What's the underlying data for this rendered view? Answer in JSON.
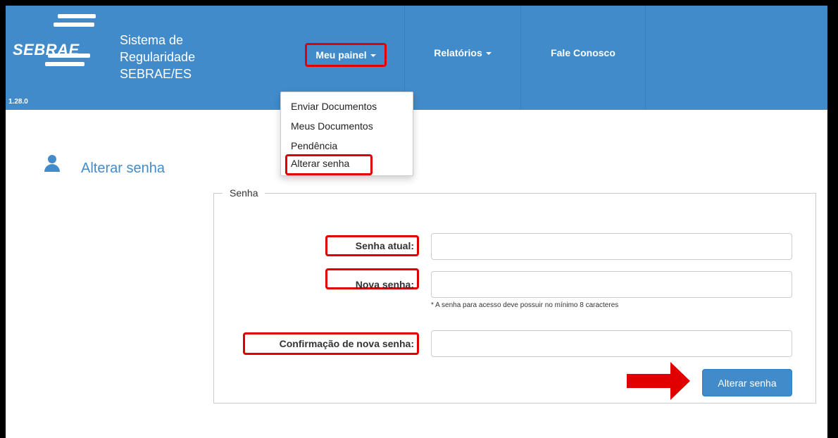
{
  "brand": {
    "logo_text": "SEBRAE",
    "title_line1": "Sistema de",
    "title_line2": "Regularidade",
    "title_line3": "SEBRAE/ES",
    "version": "1.28.0"
  },
  "nav": {
    "items": [
      {
        "label": "Meu painel"
      },
      {
        "label": "Relatórios"
      },
      {
        "label": "Fale Conosco"
      }
    ]
  },
  "dropdown": {
    "items": [
      {
        "label": "Enviar Documentos"
      },
      {
        "label": "Meus Documentos"
      },
      {
        "label": "Pendência"
      },
      {
        "label": "Alterar senha"
      }
    ]
  },
  "page": {
    "title": "Alterar senha",
    "fieldset_legend": "Senha"
  },
  "form": {
    "current_password_label": "Senha atual:",
    "new_password_label": "Nova senha:",
    "confirm_password_label": "Confirmação de nova senha:",
    "current_password_value": "",
    "new_password_value": "",
    "confirm_password_value": "",
    "hint": "* A senha para acesso deve possuir no mínimo 8 caracteres",
    "submit_label": "Alterar senha"
  },
  "colors": {
    "primary": "#428bca",
    "highlight": "#e00000"
  },
  "icons": {
    "user": "user-icon",
    "arrow": "right-arrow-icon"
  }
}
